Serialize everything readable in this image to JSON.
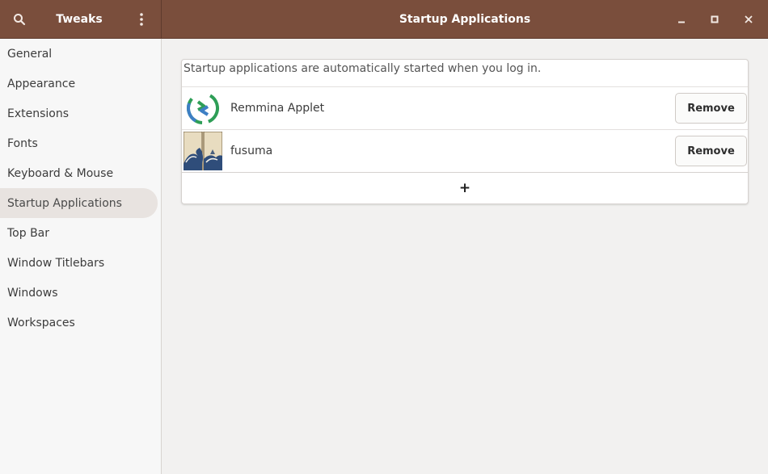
{
  "header": {
    "app_title": "Tweaks",
    "page_title": "Startup Applications"
  },
  "sidebar": {
    "items": [
      {
        "label": "General"
      },
      {
        "label": "Appearance"
      },
      {
        "label": "Extensions"
      },
      {
        "label": "Fonts"
      },
      {
        "label": "Keyboard & Mouse"
      },
      {
        "label": "Startup Applications",
        "selected": true
      },
      {
        "label": "Top Bar"
      },
      {
        "label": "Window Titlebars"
      },
      {
        "label": "Windows"
      },
      {
        "label": "Workspaces"
      }
    ]
  },
  "main": {
    "description": "Startup applications are automatically started when you log in.",
    "apps": [
      {
        "name": "Remmina Applet",
        "icon": "remmina-icon",
        "remove_label": "Remove"
      },
      {
        "name": "fusuma",
        "icon": "fusuma-icon",
        "remove_label": "Remove"
      }
    ],
    "add_label": "+"
  },
  "icons": {
    "search": "search-icon",
    "menu": "more-vertical-icon",
    "minimize": "minimize-icon",
    "maximize": "maximize-icon",
    "close": "close-icon"
  },
  "colors": {
    "titlebar": "#7a4e3c",
    "selected_sidebar": "#e8e3e0",
    "background": "#f2f1f0"
  }
}
